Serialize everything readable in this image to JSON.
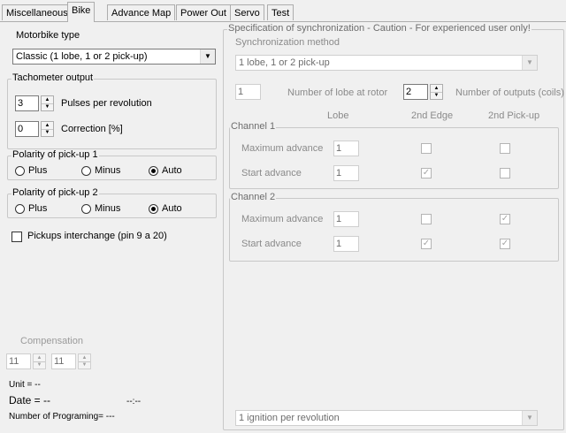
{
  "tabs": [
    {
      "label": "Miscellaneous"
    },
    {
      "label": "Bike"
    },
    {
      "label": "Advance Map"
    },
    {
      "label": "Power Out"
    },
    {
      "label": "Servo"
    },
    {
      "label": "Test"
    }
  ],
  "active_tab": "Bike",
  "left": {
    "motorbike_type": {
      "label": "Motorbike type",
      "value": "Classic (1 lobe, 1 or 2 pick-up)"
    },
    "tachometer": {
      "title": "Tachometer output",
      "pulses": {
        "value": "3",
        "label": "Pulses per revolution"
      },
      "correction": {
        "value": "0",
        "label": "Correction [%]"
      }
    },
    "polarity1": {
      "title": "Polarity of pick-up 1",
      "options": [
        "Plus",
        "Minus",
        "Auto"
      ],
      "selected": "Auto"
    },
    "polarity2": {
      "title": "Polarity of pick-up 2",
      "options": [
        "Plus",
        "Minus",
        "Auto"
      ],
      "selected": "Auto"
    },
    "pickups_interchange": {
      "label": "Pickups interchange (pin 9 a 20)",
      "checked": false
    },
    "compensation": {
      "label": "Compensation",
      "value1": "11",
      "value2": "11"
    },
    "unit": "Unit = --",
    "date": "Date = --",
    "time": "--:--",
    "programing": "Number of Programing= ---"
  },
  "right": {
    "title": "Specification of synchronization - Caution - For experienced user only!",
    "sync_method": {
      "label": "Synchronization method",
      "value": "1 lobe, 1 or 2 pick-up"
    },
    "lobe_count": {
      "value": "1",
      "label": "Number of lobe at rotor"
    },
    "outputs": {
      "value": "2",
      "label": "Number of outputs (coils)"
    },
    "col_headers": [
      "Lobe",
      "2nd Edge",
      "2nd Pick-up"
    ],
    "channel1": {
      "title": "Channel 1",
      "rows": [
        {
          "label": "Maximum advance",
          "lobe": "1",
          "edge": false,
          "pickup": false
        },
        {
          "label": "Start advance",
          "lobe": "1",
          "edge": true,
          "pickup": false
        }
      ]
    },
    "channel2": {
      "title": "Channel 2",
      "rows": [
        {
          "label": "Maximum advance",
          "lobe": "1",
          "edge": false,
          "pickup": true
        },
        {
          "label": "Start advance",
          "lobe": "1",
          "edge": true,
          "pickup": true
        }
      ]
    },
    "ignition": {
      "value": "1 ignition per revolution"
    }
  }
}
